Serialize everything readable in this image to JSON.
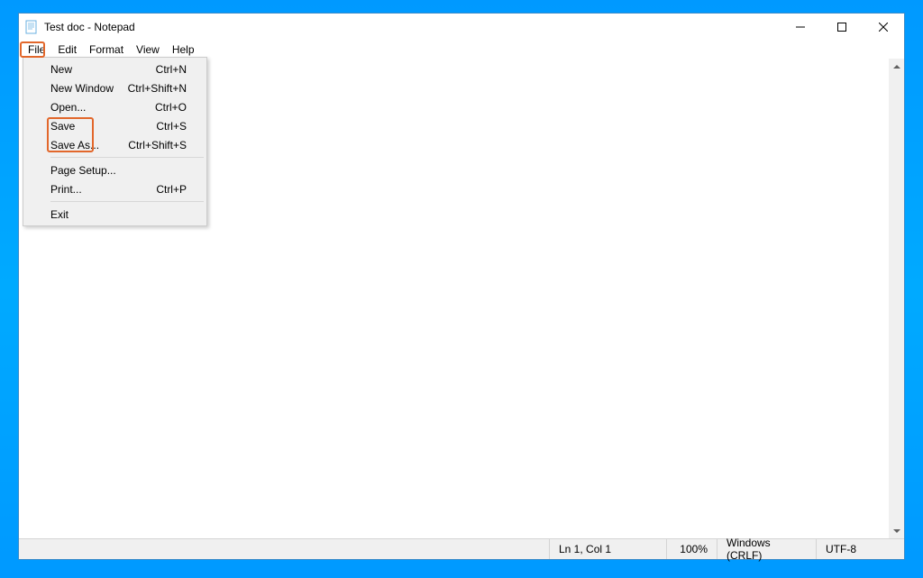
{
  "window": {
    "title": "Test doc - Notepad"
  },
  "menubar": {
    "items": [
      "File",
      "Edit",
      "Format",
      "View",
      "Help"
    ]
  },
  "file_menu": {
    "new": {
      "label": "New",
      "shortcut": "Ctrl+N"
    },
    "new_window": {
      "label": "New Window",
      "shortcut": "Ctrl+Shift+N"
    },
    "open": {
      "label": "Open...",
      "shortcut": "Ctrl+O"
    },
    "save": {
      "label": "Save",
      "shortcut": "Ctrl+S"
    },
    "save_as": {
      "label": "Save As...",
      "shortcut": "Ctrl+Shift+S"
    },
    "page_setup": {
      "label": "Page Setup...",
      "shortcut": ""
    },
    "print": {
      "label": "Print...",
      "shortcut": "Ctrl+P"
    },
    "exit": {
      "label": "Exit",
      "shortcut": ""
    }
  },
  "statusbar": {
    "position": "Ln 1, Col 1",
    "zoom": "100%",
    "line_ending": "Windows (CRLF)",
    "encoding": "UTF-8"
  }
}
